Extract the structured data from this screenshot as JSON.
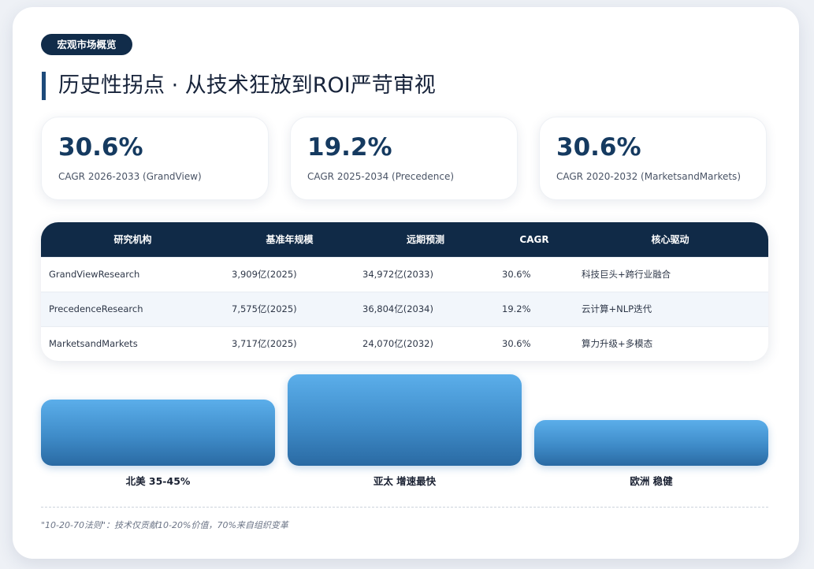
{
  "section_tag": "宏观市场概览",
  "title": "历史性拐点 · 从技术狂放到ROI严苛审视",
  "stats": [
    {
      "value": "30.6%",
      "label": "CAGR 2026-2033 (GrandView)"
    },
    {
      "value": "19.2%",
      "label": "CAGR 2025-2034 (Precedence)"
    },
    {
      "value": "30.6%",
      "label": "CAGR 2020-2032 (MarketsandMarkets)"
    }
  ],
  "table": {
    "headers": [
      "研究机构",
      "基准年规模",
      "远期预测",
      "CAGR",
      "核心驱动"
    ],
    "rows": [
      [
        "GrandViewResearch",
        "3,909亿(2025)",
        "34,972亿(2033)",
        "30.6%",
        "科技巨头+跨行业融合"
      ],
      [
        "PrecedenceResearch",
        "7,575亿(2025)",
        "36,804亿(2034)",
        "19.2%",
        "云计算+NLP迭代"
      ],
      [
        "MarketsandMarkets",
        "3,717亿(2025)",
        "24,070亿(2032)",
        "30.6%",
        "算力升级+多模态"
      ]
    ]
  },
  "regions": [
    {
      "label": "北美 35-45%",
      "relative_level": 0.72
    },
    {
      "label": "亚太 增速最快",
      "relative_level": 1.0
    },
    {
      "label": "欧洲 稳健",
      "relative_level": 0.5
    }
  ],
  "footnote": "\"10-20-70法则\"：技术仅贡献10-20%价值，70%来自组织变革",
  "colors": {
    "navy": "#102a47",
    "accent_bar": "#1d4a7a",
    "stat_value": "#153a60",
    "bar_top": "#5baeea",
    "bar_bottom": "#2a6aa3"
  }
}
